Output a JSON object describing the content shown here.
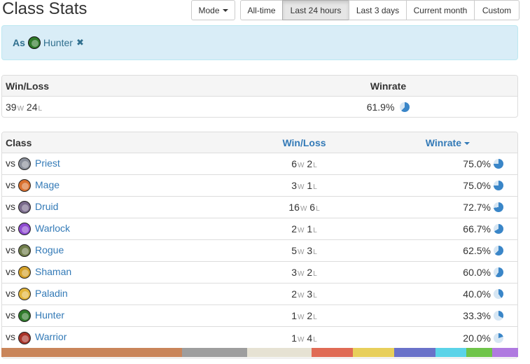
{
  "header": {
    "title": "Class Stats",
    "mode_label": "Mode"
  },
  "time_filters": [
    {
      "label": "All-time",
      "active": false
    },
    {
      "label": "Last 24 hours",
      "active": true
    },
    {
      "label": "Last 3 days",
      "active": false
    },
    {
      "label": "Current month",
      "active": false
    },
    {
      "label": "Custom",
      "active": false
    }
  ],
  "filter_alert": {
    "as_label": "As",
    "class_name": "Hunter",
    "remove_glyph": "✖"
  },
  "summary": {
    "headers": {
      "winloss": "Win/Loss",
      "winrate": "Winrate"
    },
    "wins": "39",
    "losses": "24",
    "w_suffix": "W",
    "l_suffix": "L",
    "winrate": "61.9%",
    "winrate_fraction": 0.619
  },
  "matchups": {
    "headers": {
      "class": "Class",
      "winloss": "Win/Loss",
      "winrate": "Winrate"
    },
    "vs_label": "vs",
    "rows": [
      {
        "class": "Priest",
        "wins": "6",
        "losses": "2",
        "winrate": "75.0%",
        "fraction": 0.75,
        "color": "#8a8f9a"
      },
      {
        "class": "Mage",
        "wins": "3",
        "losses": "1",
        "winrate": "75.0%",
        "fraction": 0.75,
        "color": "#d9702e"
      },
      {
        "class": "Druid",
        "wins": "16",
        "losses": "6",
        "winrate": "72.7%",
        "fraction": 0.727,
        "color": "#7a6b8c"
      },
      {
        "class": "Warlock",
        "wins": "2",
        "losses": "1",
        "winrate": "66.7%",
        "fraction": 0.667,
        "color": "#8e4bd0"
      },
      {
        "class": "Rogue",
        "wins": "5",
        "losses": "3",
        "winrate": "62.5%",
        "fraction": 0.625,
        "color": "#6f7d4a"
      },
      {
        "class": "Shaman",
        "wins": "3",
        "losses": "2",
        "winrate": "60.0%",
        "fraction": 0.6,
        "color": "#d4a12a"
      },
      {
        "class": "Paladin",
        "wins": "2",
        "losses": "3",
        "winrate": "40.0%",
        "fraction": 0.4,
        "color": "#e2b53c"
      },
      {
        "class": "Hunter",
        "wins": "1",
        "losses": "2",
        "winrate": "33.3%",
        "fraction": 0.333,
        "color": "#2f7a2a"
      },
      {
        "class": "Warrior",
        "wins": "1",
        "losses": "4",
        "winrate": "20.0%",
        "fraction": 0.2,
        "color": "#a8342a"
      }
    ]
  },
  "class_bar": [
    {
      "fraction": 0.35,
      "color": "#c9855a"
    },
    {
      "fraction": 0.125,
      "color": "#9e9e9e"
    },
    {
      "fraction": 0.125,
      "color": "#e6e2d3"
    },
    {
      "fraction": 0.08,
      "color": "#e06b55"
    },
    {
      "fraction": 0.08,
      "color": "#e8cf5b"
    },
    {
      "fraction": 0.08,
      "color": "#6a72c9"
    },
    {
      "fraction": 0.06,
      "color": "#5bd3e8"
    },
    {
      "fraction": 0.05,
      "color": "#6fc44a"
    },
    {
      "fraction": 0.05,
      "color": "#b07ae0"
    }
  ],
  "colors": {
    "pie_fill": "#3a86c8",
    "pie_empty": "#d6e6f3"
  }
}
